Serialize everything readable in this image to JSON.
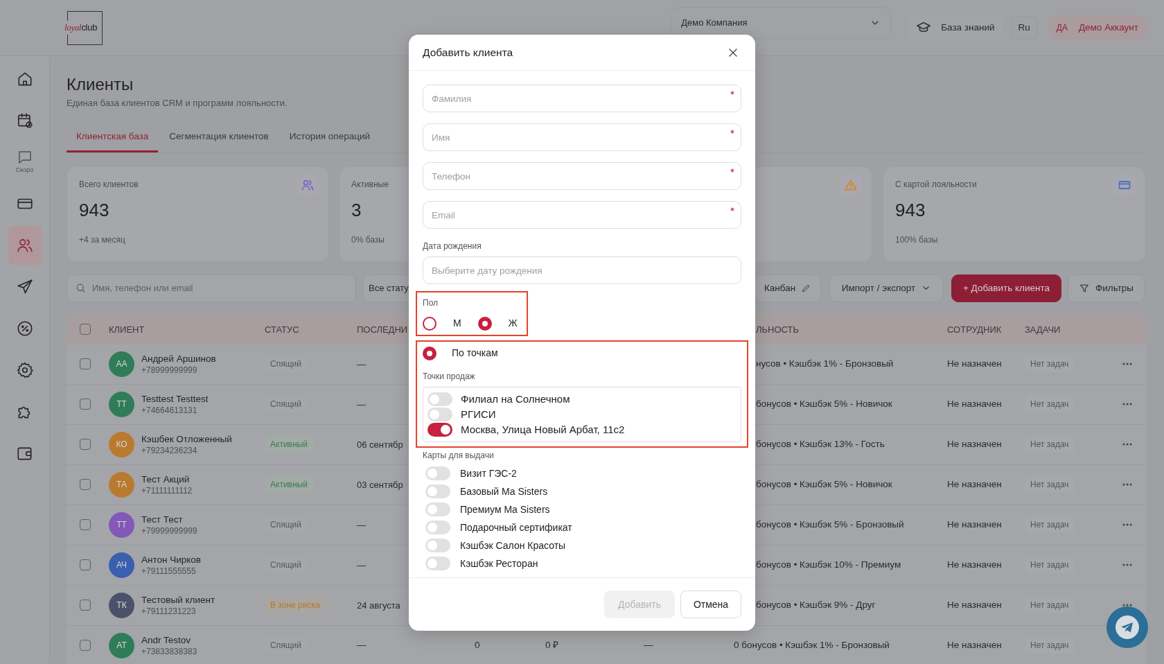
{
  "header": {
    "logo": {
      "script": "loyal",
      "plain": "club"
    },
    "company_select": "Демо Компания",
    "knowledge_base": "База знаний",
    "language": "Ru",
    "account": {
      "initials": "ДА",
      "name": "Демо Аккаунт"
    }
  },
  "sidebar": {
    "items": [
      {
        "selected": false,
        "disabled": false
      },
      {
        "selected": false,
        "disabled": false
      },
      {
        "selected": false,
        "disabled": true,
        "caption": "Скоро"
      },
      {
        "selected": false,
        "disabled": false
      },
      {
        "selected": true,
        "disabled": false
      },
      {
        "selected": false,
        "disabled": false
      },
      {
        "selected": false,
        "disabled": false
      },
      {
        "selected": false,
        "disabled": false
      },
      {
        "selected": false,
        "disabled": false
      },
      {
        "selected": false,
        "disabled": false
      }
    ]
  },
  "page": {
    "title": "Клиенты",
    "subtitle": "Единая база клиентов CRM и программ лояльности."
  },
  "tabs": [
    {
      "label": "Клиентская база",
      "selected": true
    },
    {
      "label": "Сегментация клиентов",
      "selected": false
    },
    {
      "label": "История операций",
      "selected": false
    }
  ],
  "stat_cards": [
    {
      "title": "Всего клиентов",
      "value": "943",
      "note": "+4 за месяц",
      "color": "#7a68c4"
    },
    {
      "title": "Активные",
      "value": "3",
      "note": "0% базы"
    },
    {
      "color": "#d08a2a"
    },
    {
      "title": "С картой лояльности",
      "value": "943",
      "note": "100% базы",
      "color": "#4a72c4"
    }
  ],
  "toolbar": {
    "search_placeholder": "Имя, телефон или email",
    "status_select": "Все стату",
    "kanban": "Канбан",
    "import_export": "Импорт / экспорт",
    "add_client": "+ Добавить клиента",
    "filters": "Фильтры"
  },
  "table": {
    "select_all": {
      "checked": false
    },
    "columns_left": [
      "КЛИЕНТ",
      "СТАТУС",
      "ПОСЛЕДНИ"
    ],
    "columns_right": [
      "ЛЬНОСТЬ",
      "СОТРУДНИК",
      "ЗАДАЧИ"
    ],
    "rows": [
      {
        "checked": false,
        "initials": "АА",
        "color": "#2f7d58",
        "name": "Андрей Аршинов",
        "phone": "+78999999999",
        "status": "Спящий",
        "kind": "sleeping",
        "last_visit": "—",
        "loyalty": "нусов • Кэшбэк 1% - Бронзовый",
        "employee": "Не назначен",
        "tasks": "Нет задач"
      },
      {
        "checked": false,
        "initials": "TT",
        "color": "#2f7d58",
        "name": "Testtest Testtest",
        "phone": "+74664613131",
        "status": "Спящий",
        "kind": "sleeping",
        "last_visit": "—",
        "loyalty": "бонусов • Кэшбэк 5% - Новичок",
        "employee": "Не назначен",
        "tasks": "Нет задач"
      },
      {
        "checked": false,
        "initials": "КО",
        "color": "#b97a2e",
        "name": "Кэшбек Отложенный",
        "phone": "+79234236234",
        "status": "Активный",
        "kind": "active",
        "last_visit": "06 сентябр",
        "loyalty": "бонусов • Кэшбэк 13% - Гость",
        "employee": "Не назначен",
        "tasks": "Нет задач"
      },
      {
        "checked": false,
        "initials": "ТА",
        "color": "#b97a2e",
        "name": "Тест Акций",
        "phone": "+71111111112",
        "status": "Активный",
        "kind": "active",
        "last_visit": "03 сентябр",
        "loyalty": "бонусов • Кэшбэк 5% - Новичок",
        "employee": "Не назначен",
        "tasks": "Нет задач"
      },
      {
        "checked": false,
        "initials": "ТТ",
        "color": "#8358b8",
        "name": "Тест Тест",
        "phone": "+79999999999",
        "status": "Спящий",
        "kind": "sleeping",
        "last_visit": "—",
        "loyalty": "бонусов • Кэшбэк 5% - Бронзовый",
        "employee": "Не назначен",
        "tasks": "Нет задач"
      },
      {
        "checked": false,
        "initials": "АЧ",
        "color": "#3a5fae",
        "name": "Антон Чирков",
        "phone": "+79111555555",
        "status": "Спящий",
        "kind": "sleeping",
        "last_visit": "—",
        "loyalty": "бонусов • Кэшбэк 10% - Премиум",
        "employee": "Не назначен",
        "tasks": "Нет задач"
      },
      {
        "checked": false,
        "initials": "ТК",
        "color": "#4b5168",
        "name": "Тестовый клиент",
        "phone": "+79111231223",
        "status": "В зоне риска",
        "kind": "risk",
        "last_visit": "24 августа",
        "loyalty": "бонусов • Кэшбэк 9% - Друг",
        "employee": "Не назначен",
        "tasks": "Нет задач"
      },
      {
        "checked": false,
        "initials": "AT",
        "color": "#2f7d58",
        "name": "Andr Testov",
        "phone": "+73833838383",
        "status": "Спящий",
        "kind": "sleeping",
        "last_visit": "—",
        "column_4": "0",
        "column_5": "0 ₽",
        "column_6": "—",
        "loyalty": "0 бонусов • Кэшбэк 1% - Бронзовый",
        "employee": "Не назначен",
        "tasks": "Нет задач"
      }
    ]
  },
  "modal": {
    "title": "Добавить клиента",
    "fields": [
      {
        "placeholder": "Фамилия",
        "required": true
      },
      {
        "placeholder": "Имя",
        "required": true
      },
      {
        "placeholder": "Телефон",
        "required": true
      },
      {
        "placeholder": "Email",
        "required": true
      }
    ],
    "birth_date": {
      "label": "Дата рождения",
      "placeholder": "Выберите дату рождения"
    },
    "gender": {
      "label": "Пол",
      "highlighted": true,
      "options": [
        {
          "label": "М",
          "selected": false
        },
        {
          "label": "Ж",
          "selected": true
        }
      ]
    },
    "points": {
      "highlighted": true,
      "mode": {
        "label": "По точкам",
        "selected": true
      },
      "label": "Точки продаж",
      "items": [
        {
          "label": "Филиал на Солнечном",
          "on": false
        },
        {
          "label": "РГИСИ",
          "on": false
        },
        {
          "label": "Москва, Улица Новый Арбат, 11с2",
          "on": true
        }
      ]
    },
    "cards": {
      "label": "Карты для выдачи",
      "items": [
        {
          "label": "Визит ГЭС-2",
          "on": false
        },
        {
          "label": "Базовый Ma Sisters",
          "on": false
        },
        {
          "label": "Премиум Ma Sisters",
          "on": false
        },
        {
          "label": "Подарочный сертификат",
          "on": false
        },
        {
          "label": "Кэшбэк Салон Красоты",
          "on": false
        },
        {
          "label": "Кэшбэк Ресторан",
          "on": false
        }
      ]
    },
    "buttons": [
      {
        "label": "Добавить",
        "disabled": true
      },
      {
        "label": "Отмена",
        "disabled": false
      }
    ]
  }
}
